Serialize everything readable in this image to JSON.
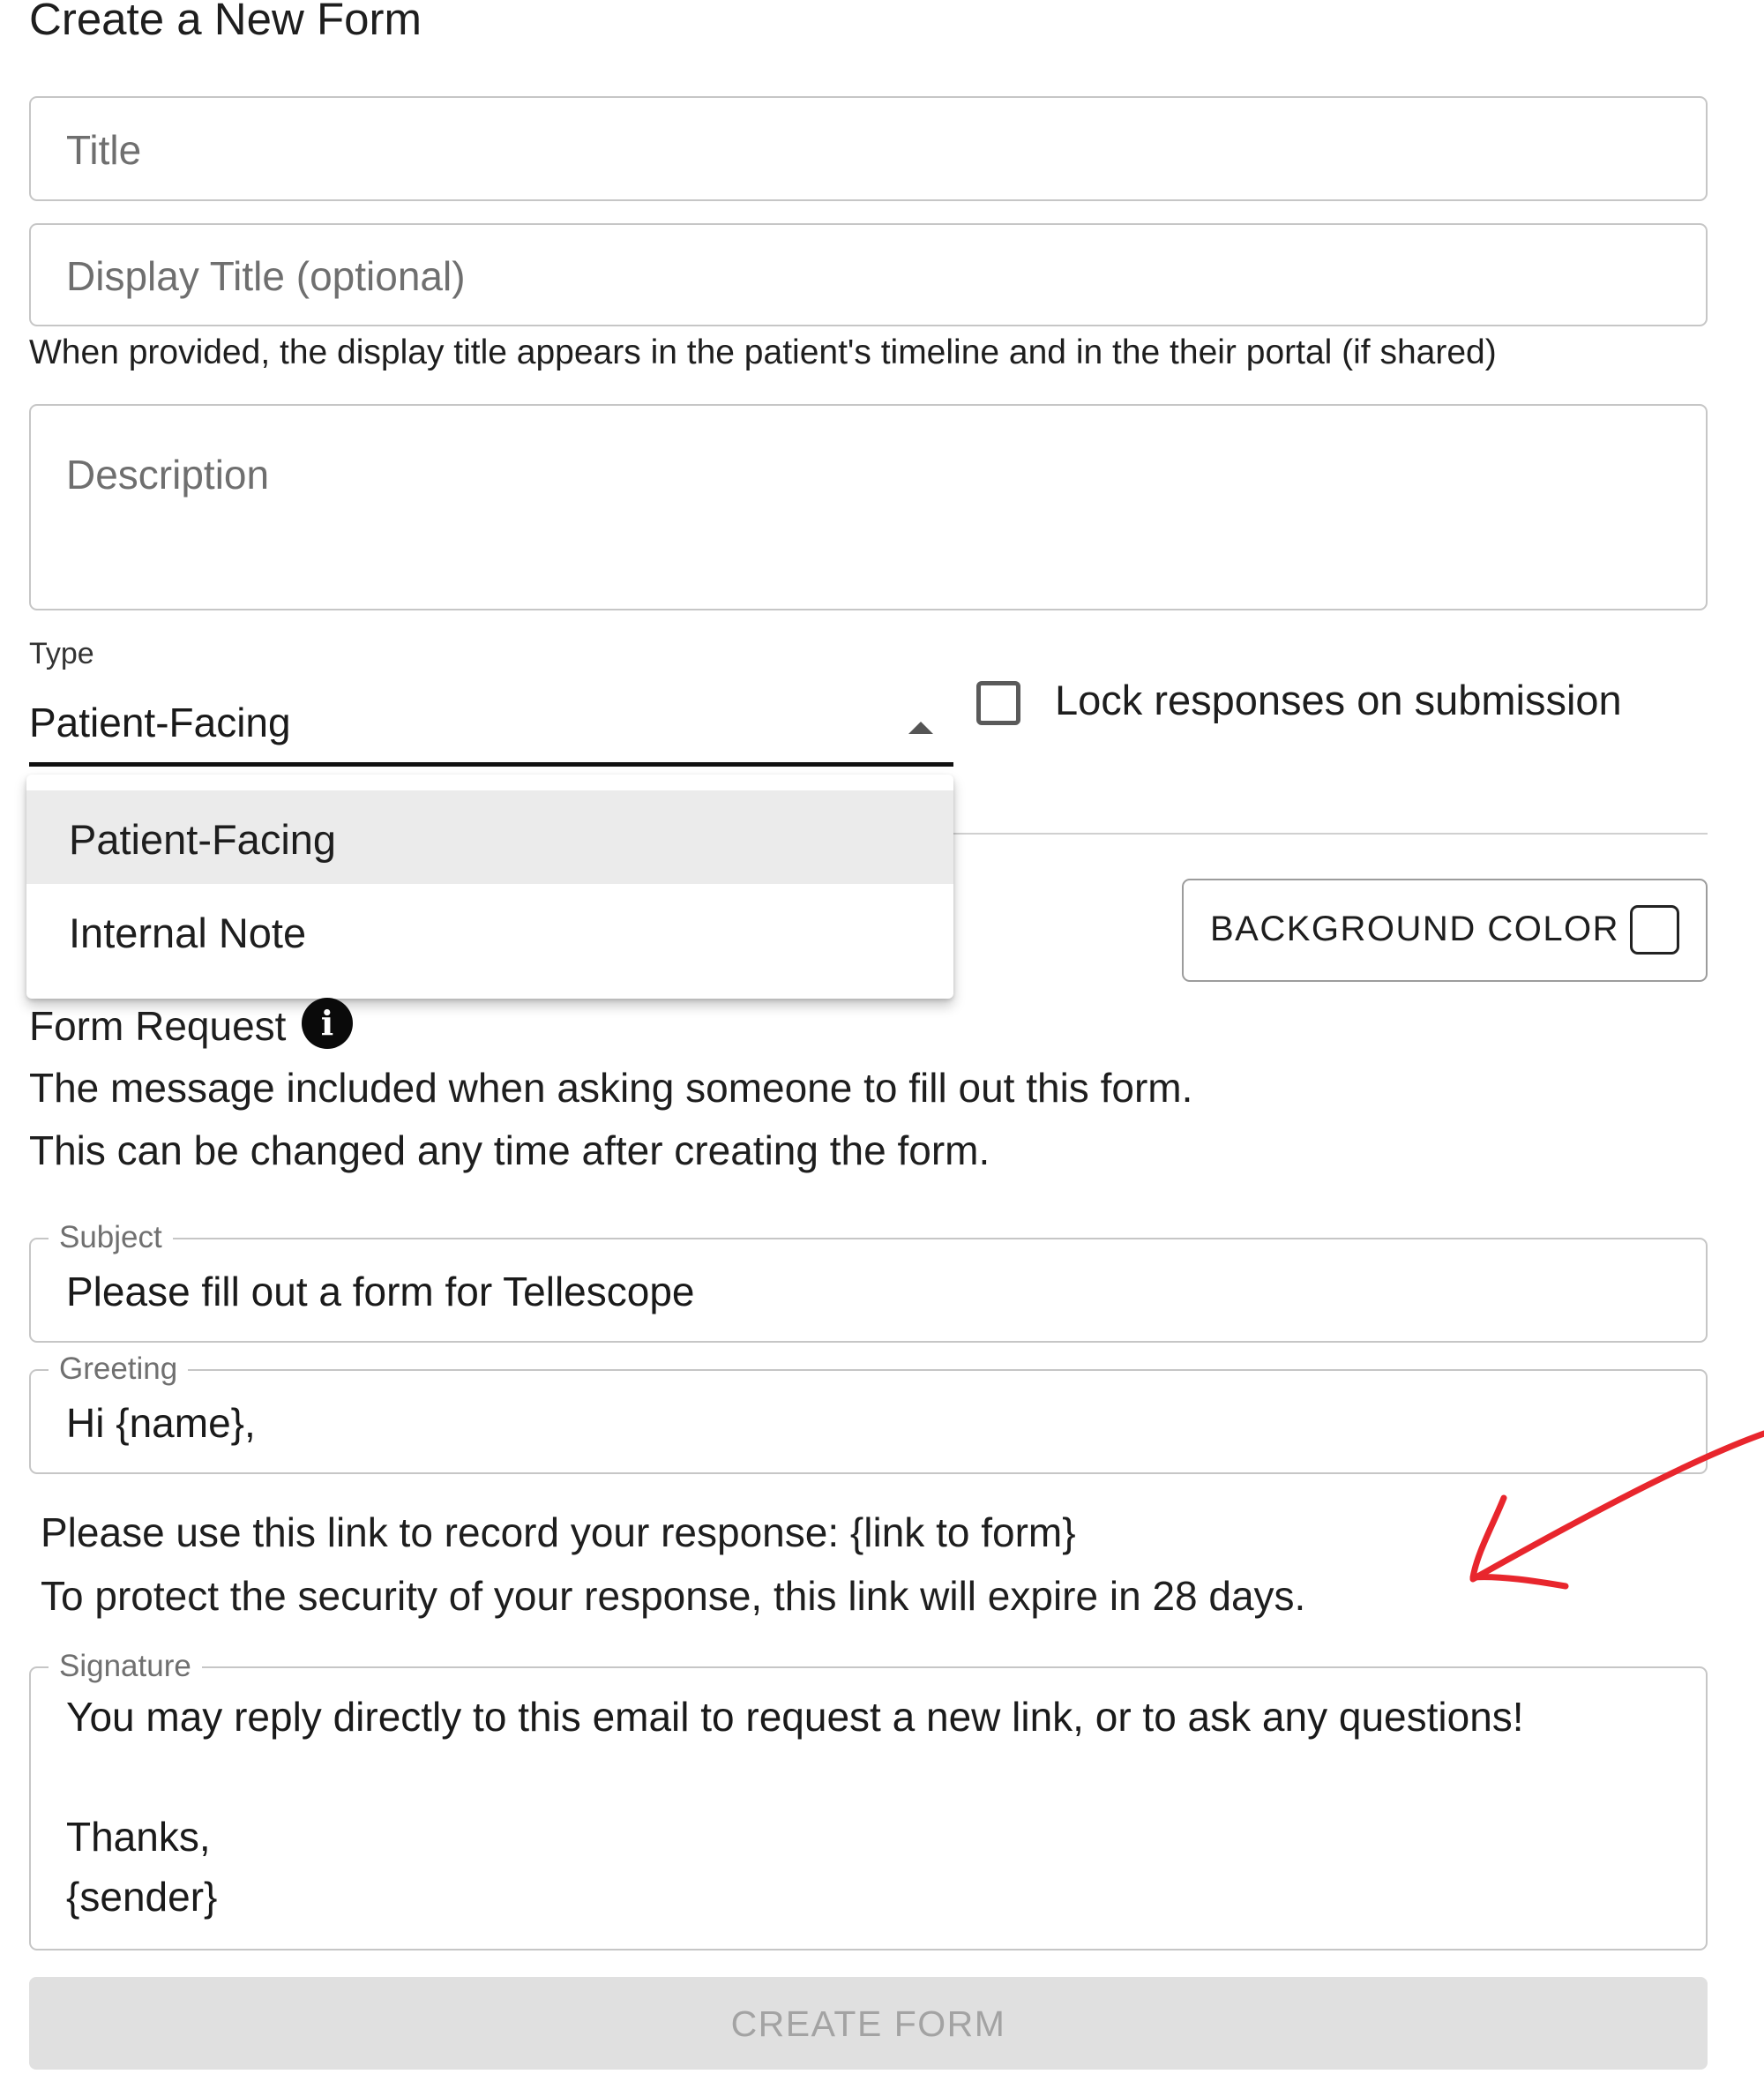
{
  "page": {
    "title": "Create a New Form"
  },
  "fields": {
    "title": {
      "placeholder": "Title"
    },
    "display_title": {
      "placeholder": "Display Title (optional)",
      "helper": "When provided, the display title appears in the patient's timeline and in the their portal (if shared)"
    },
    "description": {
      "placeholder": "Description"
    }
  },
  "type_select": {
    "label": "Type",
    "value": "Patient-Facing",
    "options": [
      "Patient-Facing",
      "Internal Note"
    ],
    "selected_index": 0
  },
  "lock_responses": {
    "label": "Lock responses on submission",
    "checked": false
  },
  "background_color": {
    "label": "BACKGROUND COLOR"
  },
  "form_request": {
    "title": "Form Request",
    "description_lines": [
      "The message included when asking someone to fill out this form.",
      "This can be changed any time after creating the form."
    ],
    "subject": {
      "label": "Subject",
      "value": "Please fill out a form for Tellescope"
    },
    "greeting": {
      "label": "Greeting",
      "value": "Hi {name},"
    },
    "body_lines": [
      "Please use this link to record your response: {link to form}",
      "To protect the security of your response, this link will expire in 28 days."
    ],
    "signature": {
      "label": "Signature",
      "lines": [
        "You may reply directly to this email to request a new link, or to ask any questions!",
        "Thanks,",
        "{sender}"
      ]
    }
  },
  "actions": {
    "create_label": "CREATE FORM",
    "create_disabled": true
  },
  "annotation": {
    "color": "#e8262d"
  }
}
